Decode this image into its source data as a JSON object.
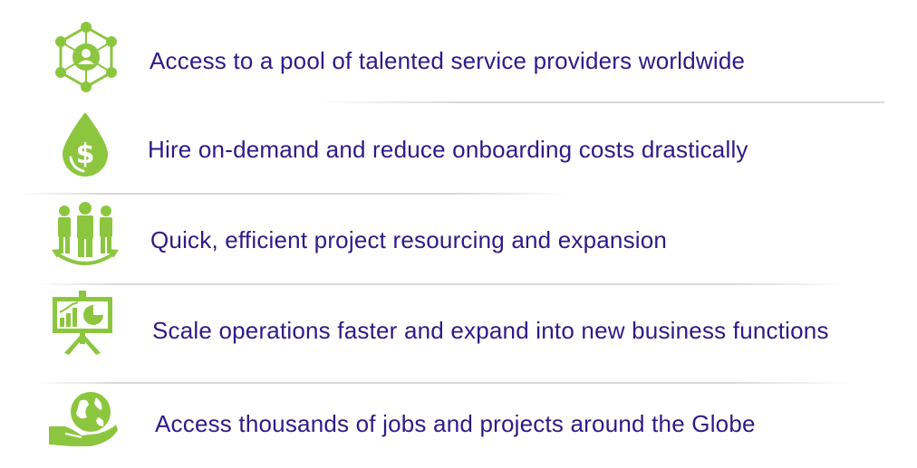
{
  "colors": {
    "icon_green": "#8cc63f",
    "text_purple": "#2e1a87",
    "divider_gray": "#d9d9d9"
  },
  "items": [
    {
      "icon": "network-people-icon",
      "label": "Access to a pool of talented service providers worldwide"
    },
    {
      "icon": "money-drop-icon",
      "label": "Hire on-demand and reduce onboarding costs drastically"
    },
    {
      "icon": "team-cycle-icon",
      "label": "Quick, efficient project resourcing and expansion"
    },
    {
      "icon": "presentation-board-icon",
      "label": "Scale operations faster and expand into new business functions"
    },
    {
      "icon": "globe-hand-icon",
      "label": "Access thousands of jobs and projects around the Globe"
    }
  ]
}
